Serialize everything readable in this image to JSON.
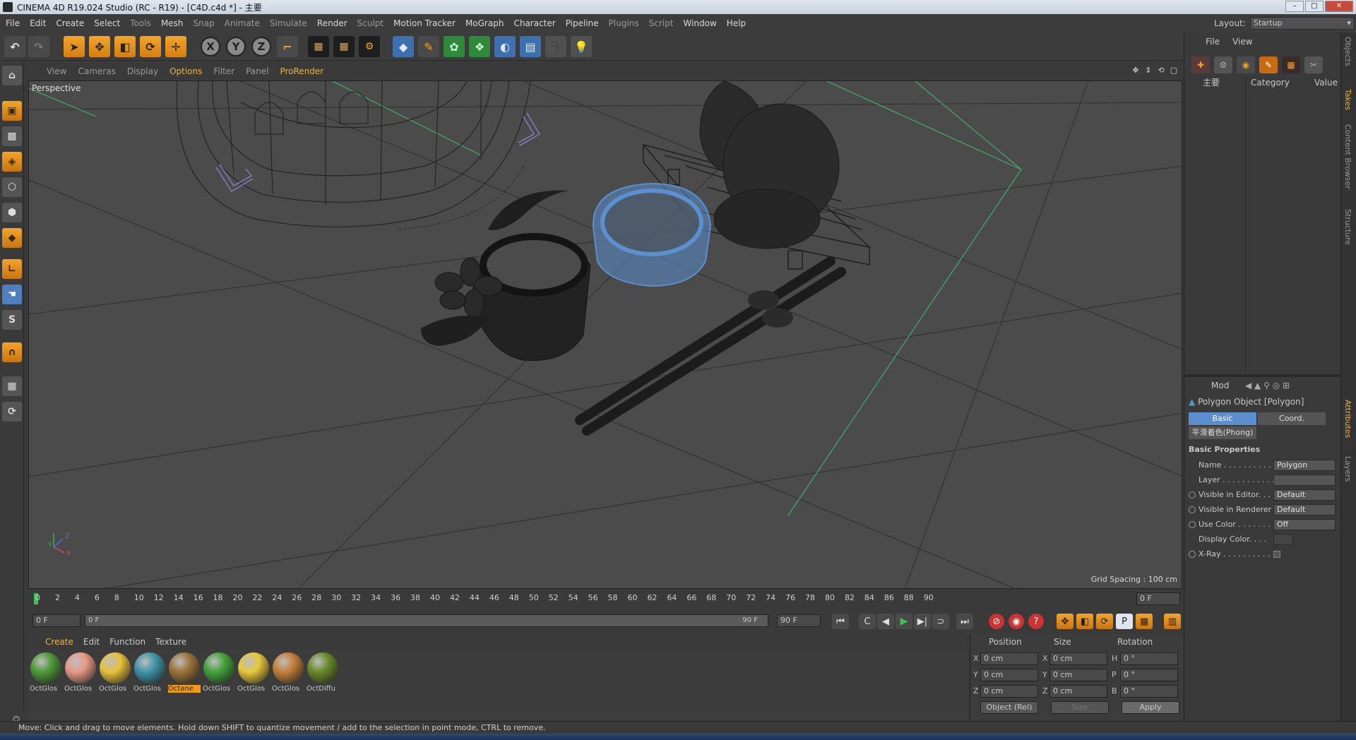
{
  "window": {
    "title": "CINEMA 4D R19.024 Studio (RC - R19) - [C4D.c4d *] - 主要"
  },
  "menu": [
    "File",
    "Edit",
    "Create",
    "Select",
    "Tools",
    "Mesh",
    "Snap",
    "Animate",
    "Simulate",
    "Render",
    "Sculpt",
    "Motion Tracker",
    "MoGraph",
    "Character",
    "Pipeline",
    "Plugins",
    "Script",
    "Window",
    "Help"
  ],
  "layout": {
    "label": "Layout:",
    "value": "Startup"
  },
  "viewport": {
    "menu": [
      "View",
      "Cameras",
      "Display",
      "Options",
      "Filter",
      "Panel",
      "ProRender"
    ],
    "label": "Perspective",
    "grid_spacing": "Grid Spacing : 100 cm",
    "axis": {
      "x": "X",
      "y": "Y",
      "z": "Z"
    }
  },
  "timeline": {
    "ticks": [
      "0",
      "2",
      "4",
      "6",
      "8",
      "10",
      "12",
      "14",
      "16",
      "18",
      "20",
      "22",
      "24",
      "26",
      "28",
      "30",
      "32",
      "34",
      "36",
      "38",
      "40",
      "42",
      "44",
      "46",
      "48",
      "50",
      "52",
      "54",
      "56",
      "58",
      "60",
      "62",
      "64",
      "66",
      "68",
      "70",
      "72",
      "74",
      "76",
      "78",
      "80",
      "82",
      "84",
      "86",
      "88",
      "90"
    ],
    "current_frame": "0 F",
    "start_field": "0 F",
    "slider_start": "0 F",
    "slider_end": "90 F",
    "end_field": "90 F"
  },
  "materials": {
    "menu": [
      "Create",
      "Edit",
      "Function",
      "Texture"
    ],
    "items": [
      {
        "name": "OctGlos",
        "color": "#4f9a3a"
      },
      {
        "name": "OctGlos",
        "color": "#e89a86"
      },
      {
        "name": "OctGlos",
        "color": "#e8c23a"
      },
      {
        "name": "OctGlos",
        "color": "#3f95a8"
      },
      {
        "name": "Octane",
        "color": "#9a7438"
      },
      {
        "name": "OctGlos",
        "color": "#44a23a"
      },
      {
        "name": "OctGlos",
        "color": "#e8c83a"
      },
      {
        "name": "OctGlos",
        "color": "#c4803a"
      },
      {
        "name": "OctDiffu",
        "color": "#6a8a2a"
      }
    ]
  },
  "coordinates": {
    "headers": {
      "position": "Position",
      "size": "Size",
      "rotation": "Rotation"
    },
    "axes_pos": [
      "X",
      "Y",
      "Z"
    ],
    "axes_rot": [
      "H",
      "P",
      "B"
    ],
    "position": [
      "0 cm",
      "0 cm",
      "0 cm"
    ],
    "size": [
      "0 cm",
      "0 cm",
      "0 cm"
    ],
    "rotation": [
      "0 °",
      "0 °",
      "0 °"
    ],
    "mode": "Object (Rel)",
    "size_mode": "Size",
    "apply": "Apply"
  },
  "status": "Move: Click and drag to move elements. Hold down SHIFT to quantize movement / add to the selection in point mode, CTRL to remove.",
  "objects_panel": {
    "menu": [
      "File",
      "View"
    ],
    "col_name": "主要",
    "col_category": "Category",
    "col_value": "Value"
  },
  "attributes": {
    "mode": "Mod",
    "object_title": "Polygon Object [Polygon]",
    "tabs": [
      "Basic",
      "Coord."
    ],
    "phong": "平滑着色(Phong)",
    "section": "Basic Properties",
    "rows": [
      {
        "key": "Name . . . . . . . . . . .",
        "value": "Polygon",
        "radio": false
      },
      {
        "key": "Layer . . . . . . . . . . .",
        "value": "",
        "radio": false
      },
      {
        "key": "Visible in Editor. . .",
        "value": "Default",
        "radio": true
      },
      {
        "key": "Visible in Renderer",
        "value": "Default",
        "radio": true
      },
      {
        "key": "Use Color . . . . . . .",
        "value": "Off",
        "radio": true
      },
      {
        "key": "Display Color. . . .",
        "value": "",
        "radio": false
      },
      {
        "key": "X-Ray . . . . . . . . . .",
        "value": "",
        "radio": true
      }
    ]
  },
  "side_tabs": [
    "Objects",
    "Takes",
    "Content Browser",
    "Structure",
    "Attributes",
    "Layers"
  ],
  "colors": {
    "accent": "#e8b53a",
    "selection": "#5b8fd0",
    "wire": "#1c1c1c"
  }
}
